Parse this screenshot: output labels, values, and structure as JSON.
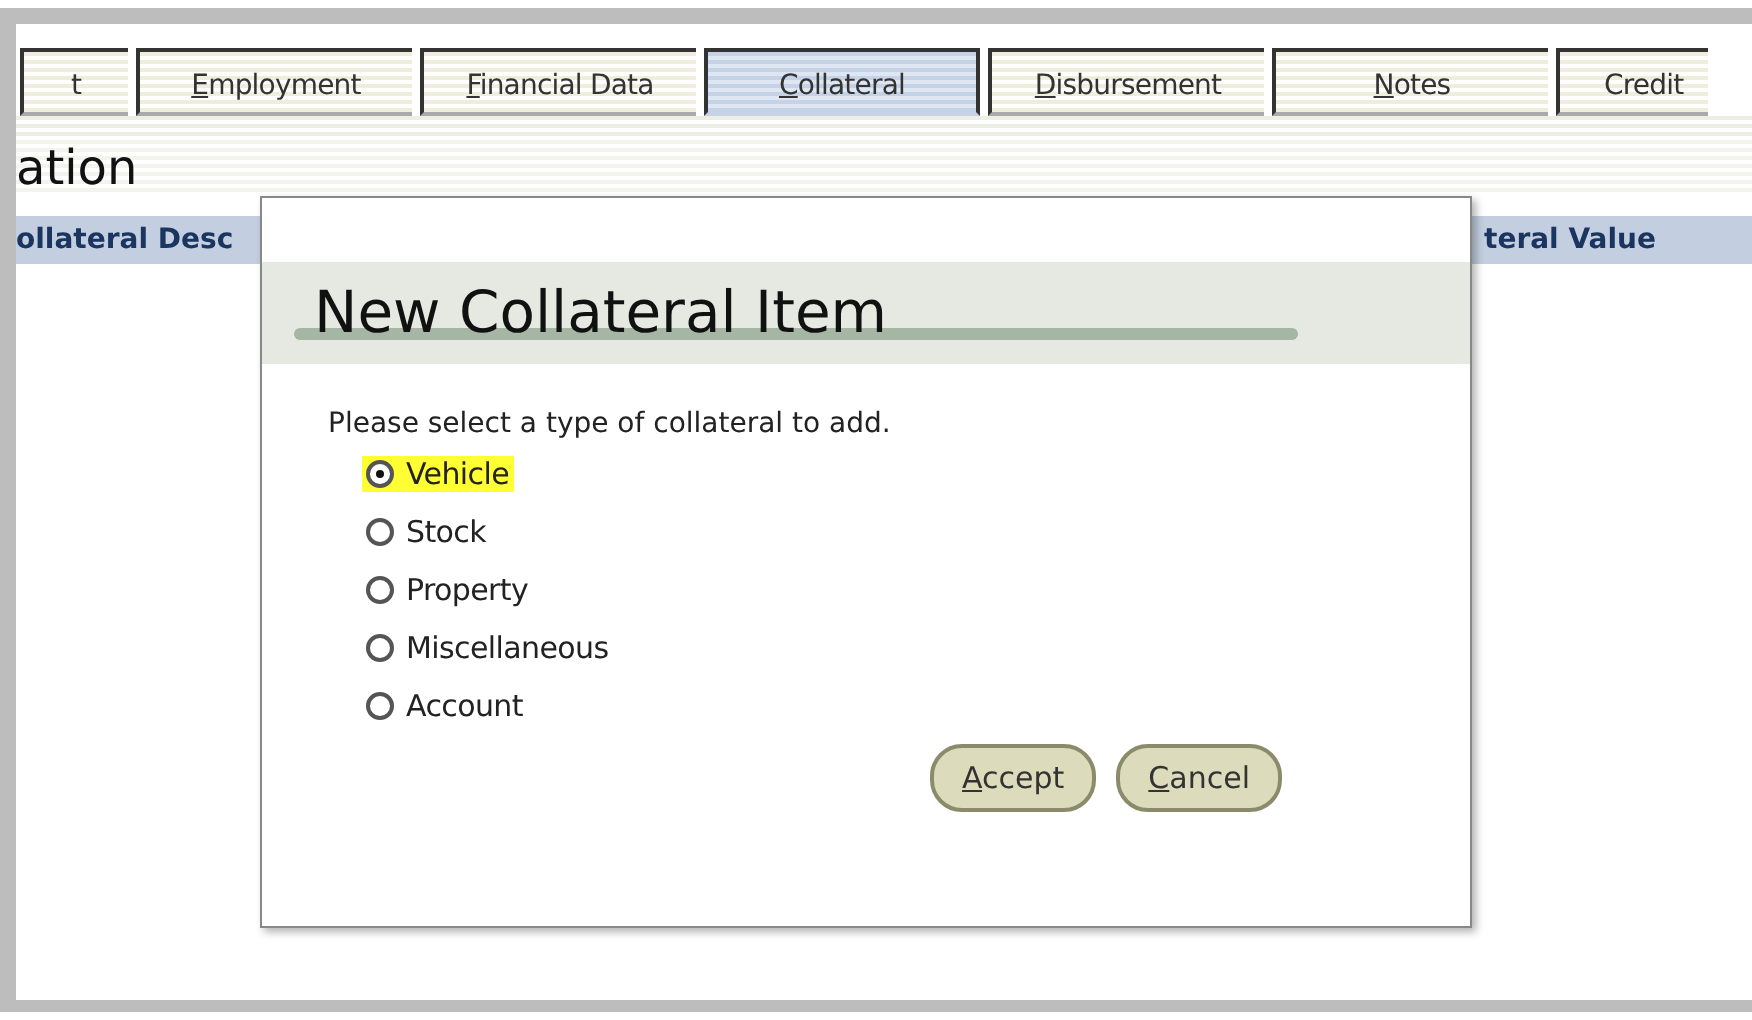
{
  "tabs": [
    {
      "label": "t",
      "underline_first": false,
      "selected": false
    },
    {
      "label": "Employment",
      "underline_first": true,
      "selected": false
    },
    {
      "label": "Financial Data",
      "underline_first": true,
      "selected": false
    },
    {
      "label": "Collateral",
      "underline_first": true,
      "selected": true
    },
    {
      "label": "Disbursement",
      "underline_first": true,
      "selected": false
    },
    {
      "label": "Notes",
      "underline_first": true,
      "selected": false
    },
    {
      "label": "Credit",
      "underline_first": false,
      "selected": false
    }
  ],
  "section_title": "ation",
  "table": {
    "columns": [
      "ollateral Desc",
      "teral Value"
    ]
  },
  "dialog": {
    "title": "New Collateral Item",
    "prompt": "Please select a type of collateral to add.",
    "options": [
      {
        "label": "Vehicle",
        "selected": true
      },
      {
        "label": "Stock",
        "selected": false
      },
      {
        "label": "Property",
        "selected": false
      },
      {
        "label": "Miscellaneous",
        "selected": false
      },
      {
        "label": "Account",
        "selected": false
      }
    ],
    "buttons": [
      "Accept",
      "Cancel"
    ]
  }
}
